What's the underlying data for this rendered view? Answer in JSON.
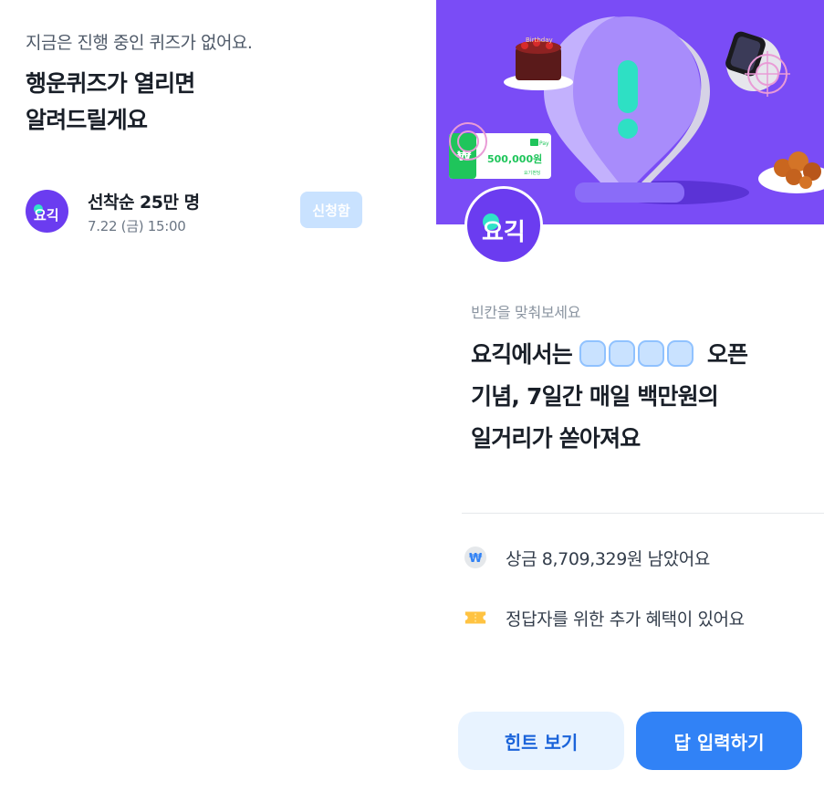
{
  "left": {
    "notice": "지금은 진행 중인 퀴즈가 없어요.",
    "headline_line1": "행운퀴즈가 열리면",
    "headline_line2": "알려드릴게요",
    "quiz": {
      "logo_text": "요긱",
      "title": "선착순 25만 명",
      "time": "7.22 (금) 15:00",
      "apply_label": "신청함"
    }
  },
  "right": {
    "banner": {
      "gift_card_amount": "500,000원",
      "gift_card_brand": "Pay",
      "gift_card_sub": "요기펀딩",
      "cake_text": "Birthday"
    },
    "logo_text": "요긱",
    "blank_label": "빈칸을 맞춰보세요",
    "question_prefix": "요긱에서는",
    "question_suffix": "오픈",
    "question_line2": "기념, 7일간 매일 백만원의",
    "question_line3": "일거리가 쏟아져요",
    "prize_remaining": "상금 8,709,329원 남았어요",
    "bonus_benefit": "정답자를 위한 추가 혜택이 있어요",
    "hint_button": "힌트 보기",
    "answer_button": "답 입력하기"
  },
  "colors": {
    "brand_purple": "#6b3cf0",
    "banner_purple": "#7a4cf6",
    "primary_blue": "#3182f6",
    "hint_bg": "#e8f3ff",
    "blank_fill": "#c9e2ff"
  }
}
